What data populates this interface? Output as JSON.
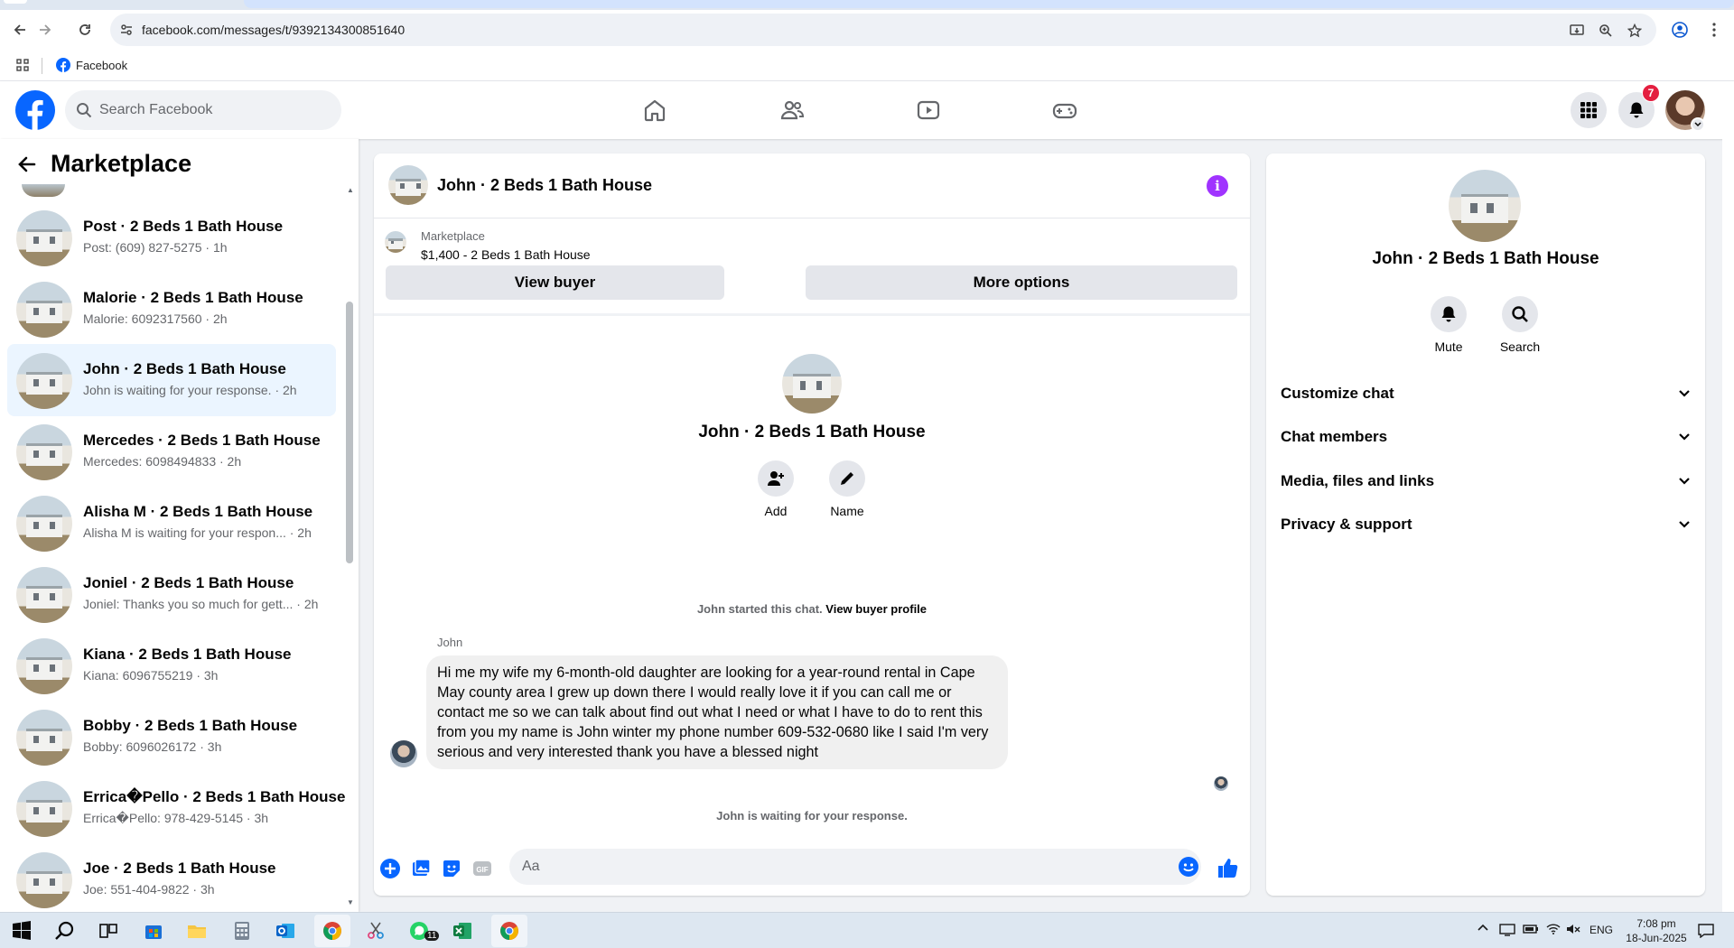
{
  "browser": {
    "url": "facebook.com/messages/t/9392134300851640",
    "bookmark_label": "Facebook"
  },
  "header": {
    "search_placeholder": "Search Facebook",
    "notification_count": "7"
  },
  "sidebar": {
    "title": "Marketplace",
    "items": [
      {
        "name": "Post · 2 Beds 1 Bath House",
        "snippet": "Post: (609) 827-5275 · 1h"
      },
      {
        "name": "Malorie · 2 Beds 1 Bath House",
        "snippet": "Malorie: 6092317560 · 2h"
      },
      {
        "name": "John · 2 Beds 1 Bath House",
        "snippet": "John is waiting for your response. · 2h"
      },
      {
        "name": "Mercedes · 2 Beds 1 Bath House",
        "snippet": "Mercedes: 6098494833 · 2h"
      },
      {
        "name": "Alisha M · 2 Beds 1 Bath House",
        "snippet": "Alisha M is waiting for your respon... · 2h"
      },
      {
        "name": "Joniel · 2 Beds 1 Bath House",
        "snippet": "Joniel: Thanks you so much for gett... · 2h"
      },
      {
        "name": "Kiana · 2 Beds 1 Bath House",
        "snippet": "Kiana: 6096755219 · 3h"
      },
      {
        "name": "Bobby · 2 Beds 1 Bath House",
        "snippet": "Bobby: 6096026172 · 3h"
      },
      {
        "name": "Errica�Pello · 2 Beds 1 Bath House",
        "snippet": "Errica�Pello: 978-429-5145 · 3h"
      },
      {
        "name": "Joe · 2 Beds 1 Bath House",
        "snippet": "Joe: 551-404-9822 · 3h"
      }
    ]
  },
  "chat": {
    "title": "John · 2 Beds 1 Bath House",
    "listing_source": "Marketplace",
    "listing_title": "$1,400 - 2 Beds 1 Bath House",
    "view_buyer_label": "View buyer",
    "more_options_label": "More options",
    "intro_name": "John · 2 Beds 1 Bath House",
    "add_label": "Add",
    "name_label": "Name",
    "started_text": "John started this chat.",
    "view_profile_link": "View buyer profile",
    "sender": "John",
    "message": "Hi me my wife my 6-month-old daughter are looking for a year-round rental in Cape May county area I grew up down there I would really love it if you can call me or contact me so we can talk about find out what I need or what I have to do to rent this from you my name is John winter my phone number 609-532-0680 like I said I'm very serious and very interested thank you have a blessed night",
    "waiting_text": "John is waiting for your response.",
    "composer_placeholder": "Aa"
  },
  "details": {
    "name": "John · 2 Beds 1 Bath House",
    "mute_label": "Mute",
    "search_label": "Search",
    "sections": [
      "Customize chat",
      "Chat members",
      "Media, files and links",
      "Privacy & support"
    ]
  },
  "taskbar": {
    "whatsapp_badge": "11",
    "language": "ENG",
    "time": "7:08 pm",
    "date": "18-Jun-2025"
  },
  "colors": {
    "brand": "#0866ff",
    "info": "#a033ff",
    "active_row": "#ebf5ff"
  }
}
